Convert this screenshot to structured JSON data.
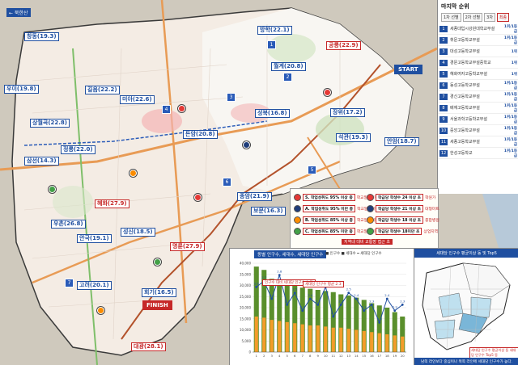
{
  "map": {
    "compass": "← 북한산",
    "start": "START",
    "finish": "FINISH",
    "stations": [
      {
        "name": "방학(22.1)",
        "red": false
      },
      {
        "name": "창동(19.3)",
        "red": false
      },
      {
        "name": "공릉(22.9)",
        "red": true
      },
      {
        "name": "월계(20.8)",
        "red": false
      },
      {
        "name": "장위(17.2)",
        "red": false
      },
      {
        "name": "길음(22.2)",
        "red": false
      },
      {
        "name": "미아(22.6)",
        "red": false
      },
      {
        "name": "석관(19.3)",
        "red": false
      },
      {
        "name": "상월곡(22.8)",
        "red": false
      },
      {
        "name": "정릉(22.0)",
        "red": false
      },
      {
        "name": "우이(19.8)",
        "red": false
      },
      {
        "name": "돈암(20.8)",
        "red": false
      },
      {
        "name": "성북(16.8)",
        "red": false
      },
      {
        "name": "종암(21.9)",
        "red": false
      },
      {
        "name": "삼선(14.3)",
        "red": false
      },
      {
        "name": "성신(18.5)",
        "red": false
      },
      {
        "name": "안암(18.7)",
        "red": false
      },
      {
        "name": "혜화(27.9)",
        "red": true
      },
      {
        "name": "명륜(27.9)",
        "red": true
      },
      {
        "name": "우촌(26.8)",
        "red": false
      },
      {
        "name": "안국(19.1)",
        "red": false
      },
      {
        "name": "회기(16.5)",
        "red": false
      },
      {
        "name": "고려(20.1)",
        "red": false
      },
      {
        "name": "대광(28.1)",
        "red": true
      },
      {
        "name": "보문(16.3)",
        "red": false
      }
    ]
  },
  "ranking": {
    "title": "마지막 순위",
    "buttons": [
      "1차 선별",
      "2차 선별",
      "3차",
      "최종"
    ],
    "rows": [
      {
        "rank": "1",
        "name": "세종대입시강원대학교부설",
        "value": "1위/1등급"
      },
      {
        "rank": "2",
        "name": "휘문고등학교부설",
        "value": "1위/1등급"
      },
      {
        "rank": "3",
        "name": "대성고등학교부설",
        "value": "1위"
      },
      {
        "rank": "4",
        "name": "경문고등학교부설중학교",
        "value": "1위"
      },
      {
        "rank": "5",
        "name": "혜화여자고등학교부설",
        "value": "1위"
      },
      {
        "rank": "6",
        "name": "동성고등학교부설",
        "value": "1위/1등급"
      },
      {
        "rank": "7",
        "name": "경신고등학교부설",
        "value": "1위/1등급"
      },
      {
        "rank": "8",
        "name": "배재고등학교부설",
        "value": "1위/1등급"
      },
      {
        "rank": "9",
        "name": "서울과학고등학교부설",
        "value": "1위/1등급"
      },
      {
        "rank": "10",
        "name": "중앙고등학교부설",
        "value": "1위/1등급"
      },
      {
        "rank": "11",
        "name": "세종고등학교부설",
        "value": "1위/1등급"
      },
      {
        "rank": "12",
        "name": "한성고등학교",
        "value": "1위/1등급"
      }
    ]
  },
  "legend": {
    "items": [
      {
        "color": "#e53935",
        "label": "S. 학업성취도 95% 이상 중",
        "sub": "학교알리미학업성취도"
      },
      {
        "color": "#1f3d7a",
        "label": "A. 학업성취도 95% 미만 중",
        "sub": "학교알리미학업성취도"
      },
      {
        "color": "#fb8c00",
        "label": "B. 학업성취도 85% 이상 중",
        "sub": "학교알리미학업성취도"
      },
      {
        "color": "#43a047",
        "label": "C. 학업성취도 85% 미만 중",
        "sub": "학교알리미학업성취도"
      },
      {
        "color": "#e53935",
        "label": "학급당 학생수 24 이상 초",
        "sub": "학원가"
      },
      {
        "color": "#1f3d7a",
        "label": "학급당 학생수 21 이상 초",
        "sub": "대형마트"
      },
      {
        "color": "#fb8c00",
        "label": "학급당 학생수 18 이상 초",
        "sub": "종합병원"
      },
      {
        "color": "#43a047",
        "label": "학급당 학생수 18미만 초",
        "sub": "상업지역"
      }
    ],
    "note": "지역내 대비 교통망 접근 초"
  },
  "chart_data": {
    "type": "bar",
    "title": "동별 인구수, 세대수, 세대당 인구수",
    "legend_text": "■ 인구수 ■ 세대수 ━ 세대당 인구수",
    "annotation_1": "인구수 대비 세대당 인구수 높음",
    "annotation_2": "세대당 인구수 평균 2.3",
    "ylim": [
      0,
      40000
    ],
    "y2lim": [
      1.5,
      3.0
    ],
    "yticks": [
      "40,000",
      "35,000",
      "30,000",
      "25,000",
      "20,000",
      "15,000",
      "10,000",
      "5,000",
      "0"
    ],
    "categories": [
      "1",
      "2",
      "3",
      "4",
      "5",
      "6",
      "7",
      "8",
      "9",
      "10",
      "11",
      "12",
      "13",
      "14",
      "15",
      "16",
      "17",
      "18",
      "19",
      "20"
    ],
    "series": [
      {
        "values": [
          38500,
          37000,
          33000,
          32000,
          31500,
          30000,
          29000,
          28500,
          28000,
          27500,
          27000,
          26000,
          25500,
          24500,
          23500,
          22000,
          21000,
          20000,
          18000,
          16000
        ]
      },
      {
        "values": [
          16000,
          15500,
          14500,
          14000,
          13500,
          13000,
          12500,
          12000,
          12000,
          11500,
          11000,
          11000,
          10500,
          10000,
          9500,
          9000,
          8500,
          8000,
          7500,
          7000
        ]
      },
      {
        "values": [
          2.6,
          2.7,
          2.4,
          2.8,
          2.3,
          2.5,
          2.2,
          2.4,
          2.3,
          2.6,
          2.1,
          2.3,
          2.5,
          2.4,
          2.2,
          2.3,
          2.0,
          2.4,
          2.2,
          2.3
        ]
      }
    ],
    "labels": [
      "2.6",
      "2.7",
      "2.4",
      "2.8",
      "2.3",
      "2.5",
      "2.2",
      "2.4",
      "2.3",
      "2.6",
      "2.1",
      "2.3",
      "2.5",
      "2.4",
      "2.2",
      "2.3",
      "2.0",
      "2.4",
      "2.2",
      "2.3"
    ]
  },
  "inset": {
    "title": "세대당 인구수 평균이상 동 및 Top5",
    "note": "세대당 인구수 평균이상 동\n세대당 인구수 Top5 동",
    "bottom": "남쪽 라인보다 중심이나 북쪽 라인에 세대당 인구수가 높다."
  }
}
